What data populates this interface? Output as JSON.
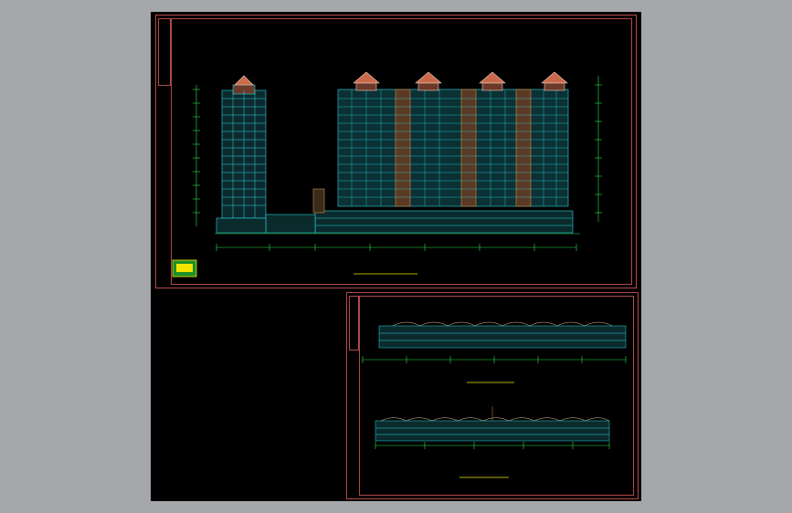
{
  "viewer": {
    "background_color": "#a6a7ab",
    "canvas_color": "#000000",
    "frame_color": "#b04a4a"
  },
  "drawings": {
    "sheet1": {
      "caption": "",
      "caption_color": "#f2e600",
      "building_color": "#2ad6e0",
      "dimension_color": "#2ee04a"
    },
    "sheet2": {
      "caption_top": "",
      "caption_bottom": "",
      "caption_color": "#f2e600"
    }
  },
  "icons": [
    "cad-logo-icon"
  ]
}
